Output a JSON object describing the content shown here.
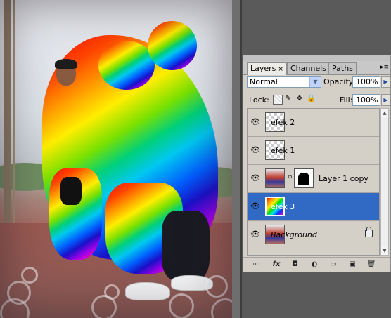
{
  "panel": {
    "menu_icon": "panel-menu-icon",
    "tabs": [
      {
        "label": "Layers",
        "close": "×"
      },
      {
        "label": "Channels"
      },
      {
        "label": "Paths"
      }
    ],
    "blend_mode": "Normal",
    "opacity_label": "Opacity:",
    "opacity_value": "100%",
    "lock_label": "Lock:",
    "fill_label": "Fill:",
    "fill_value": "100%",
    "layers": [
      {
        "name": "efek 2",
        "thumb": "transparent",
        "visible": true,
        "selected": false
      },
      {
        "name": "efek 1",
        "thumb": "transparent",
        "visible": true,
        "selected": false
      },
      {
        "name": "Layer 1 copy",
        "thumb": "photo",
        "has_mask": true,
        "visible": true,
        "selected": false
      },
      {
        "name": "efek 3",
        "thumb": "rainbow",
        "visible": true,
        "selected": true
      },
      {
        "name": "Background",
        "thumb": "photo",
        "italic": true,
        "locked": true,
        "visible": true,
        "selected": false
      }
    ],
    "bottom_icons": [
      "link-layers-icon",
      "fx-icon",
      "add-mask-icon",
      "adjustment-layer-icon",
      "new-group-icon",
      "new-layer-icon",
      "trash-icon"
    ],
    "glyphs": {
      "eye": "👁",
      "link": "∞",
      "fx": "fx",
      "mask": "◘",
      "adjust": "◐",
      "folder": "▭",
      "new": "▣",
      "trash": "🗑",
      "dd": "▼",
      "arrow": "▶",
      "menu": "▸≡",
      "chain": "⚲"
    }
  },
  "canvas": {
    "image": "photo-with-rainbow-gradient-effect",
    "colors": {
      "selection": "#316ac5",
      "panel_bg": "#d4d0c8"
    }
  }
}
